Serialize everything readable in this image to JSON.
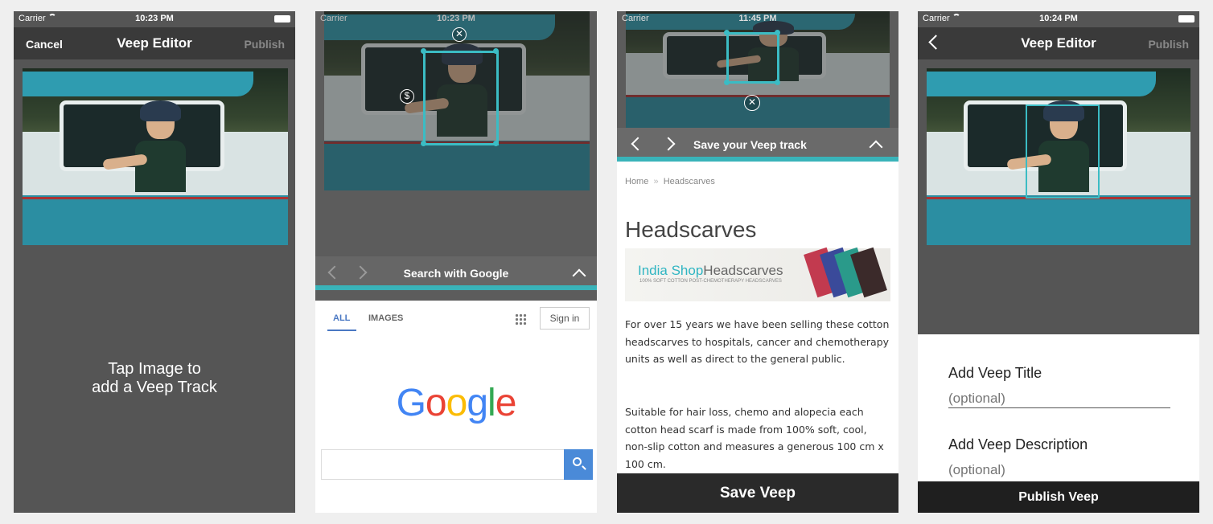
{
  "status": {
    "carrier": "Carrier",
    "time_1": "10:23 PM",
    "time_2": "10:23 PM",
    "time_3": "11:45 PM",
    "time_4": "10:24 PM"
  },
  "screen1": {
    "nav": {
      "left": "Cancel",
      "title": "Veep Editor",
      "right": "Publish"
    },
    "hint_line1": "Tap Image to",
    "hint_line2": "add a Veep Track"
  },
  "screen2": {
    "dollar_symbol": "$",
    "close_symbol": "✕",
    "bar_title": "Search with Google",
    "tabs": [
      "ALL",
      "IMAGES"
    ],
    "sign_in": "Sign in",
    "logo": [
      "G",
      "o",
      "o",
      "g",
      "l",
      "e"
    ],
    "logo_colors": [
      "#4285F4",
      "#EA4335",
      "#FBBC05",
      "#4285F4",
      "#34A853",
      "#EA4335"
    ],
    "search_value": ""
  },
  "screen3": {
    "bar_title": "Save your Veep track",
    "breadcrumb": [
      "Home",
      "»",
      "Headscarves"
    ],
    "heading": "Headscarves",
    "banner_name_1": "India Shop",
    "banner_name_2": "Headscarves",
    "banner_sub": "100% SOFT COTTON POST-CHEMOTHERAPY HEADSCARVES",
    "para1": "For over 15 years we have been selling these cotton headscarves to hospitals, cancer and chemotherapy units as well as direct to the general public.",
    "para2": "Suitable for hair loss, chemo and alopecia each cotton head scarf is made from 100% soft, cool, non-slip cotton and measures a generous 100 cm x 100 cm.",
    "save_button": "Save Veep"
  },
  "screen4": {
    "nav": {
      "title": "Veep Editor",
      "right": "Publish"
    },
    "title_label": "Add Veep Title",
    "title_placeholder": "(optional)",
    "desc_label": "Add Veep Description",
    "desc_placeholder": "(optional)",
    "publish_button": "Publish Veep"
  },
  "colors": {
    "accent": "#3bbcc4",
    "nav_bg": "#3a3a3a",
    "button_bg": "#2a2a2a"
  }
}
